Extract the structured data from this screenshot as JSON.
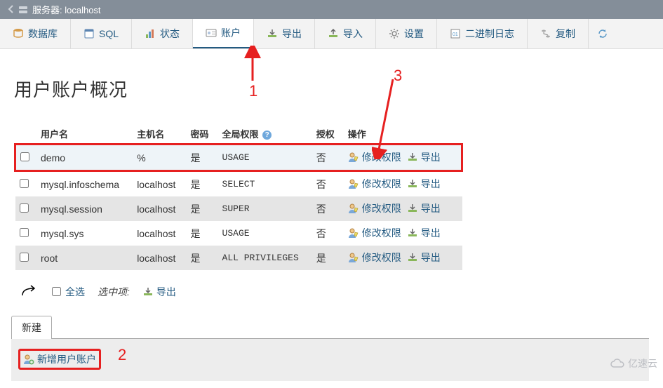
{
  "titlebar": {
    "server_label": "服务器: localhost"
  },
  "tabs": {
    "database": "数据库",
    "sql": "SQL",
    "status": "状态",
    "accounts": "账户",
    "export": "导出",
    "import": "导入",
    "settings": "设置",
    "binlog": "二进制日志",
    "replication": "复制"
  },
  "heading": "用户账户概况",
  "columns": {
    "user": "用户名",
    "host": "主机名",
    "password": "密码",
    "global_priv": "全局权限",
    "grant": "授权",
    "action": "操作"
  },
  "rows": [
    {
      "user": "demo",
      "host": "%",
      "password": "是",
      "priv": "USAGE",
      "grant": "否"
    },
    {
      "user": "mysql.infoschema",
      "host": "localhost",
      "password": "是",
      "priv": "SELECT",
      "grant": "否"
    },
    {
      "user": "mysql.session",
      "host": "localhost",
      "password": "是",
      "priv": "SUPER",
      "grant": "否"
    },
    {
      "user": "mysql.sys",
      "host": "localhost",
      "password": "是",
      "priv": "USAGE",
      "grant": "否"
    },
    {
      "user": "root",
      "host": "localhost",
      "password": "是",
      "priv": "ALL PRIVILEGES",
      "grant": "是"
    }
  ],
  "actions": {
    "edit_priv": "修改权限",
    "export": "导出"
  },
  "footer": {
    "select_all": "全选",
    "selected_items": "选中项:",
    "export": "导出"
  },
  "newbox": {
    "title": "新建",
    "add_user": "新增用户账户"
  },
  "annotations": {
    "a1": "1",
    "a2": "2",
    "a3": "3"
  },
  "watermark": "亿速云"
}
